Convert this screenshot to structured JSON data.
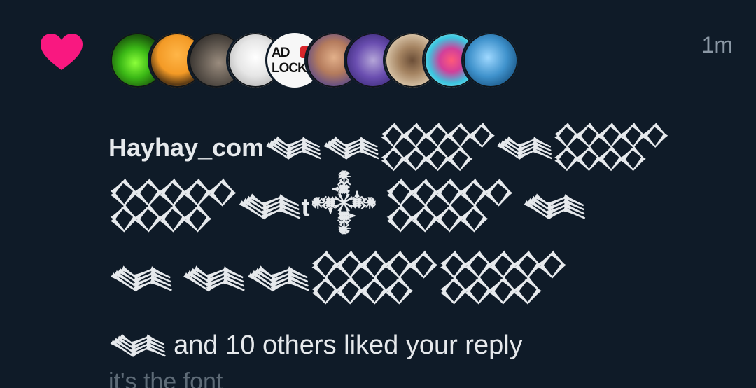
{
  "notification": {
    "time": "1m",
    "username": "Hayhay_com",
    "name_glyphs_line1": "𒈝𒈝𒐫𒈝𒐫",
    "name_glyphs_line2a": "𒐫𒈝",
    "name_t": "t",
    "name_glyphs_line2b": "𒀱 𒐫 𒈝",
    "name_glyphs_line3": "𒈝 𒈝𒈝𒐫𒐫",
    "name_glyphs_line4": "𒈝",
    "action_text": " and 10 others liked your reply",
    "reply_preview": "it's the font",
    "avatars": [
      {
        "name": "avatar-1"
      },
      {
        "name": "avatar-2"
      },
      {
        "name": "avatar-3"
      },
      {
        "name": "avatar-4"
      },
      {
        "name": "avatar-5",
        "text": "AD\nLOCK"
      },
      {
        "name": "avatar-6"
      },
      {
        "name": "avatar-7"
      },
      {
        "name": "avatar-8"
      },
      {
        "name": "avatar-9"
      },
      {
        "name": "avatar-10"
      }
    ],
    "heart_color": "#f91880"
  }
}
